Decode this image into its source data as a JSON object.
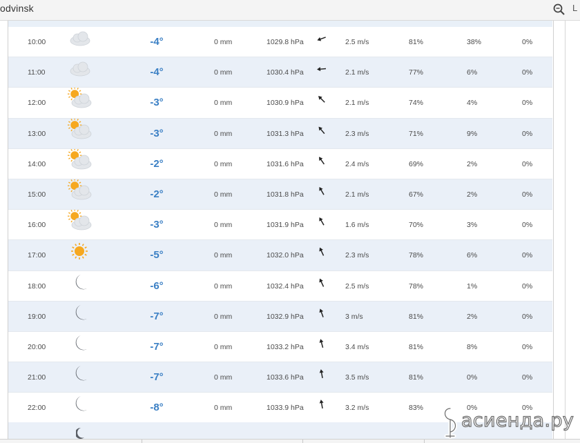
{
  "window": {
    "title": "odvinsk",
    "zoom_icon": "magnifier-icon",
    "cut_label": "L"
  },
  "columns": [
    "time",
    "condition",
    "temperature",
    "precipitation",
    "pressure",
    "wind_direction",
    "wind_speed",
    "humidity",
    "probability",
    "last"
  ],
  "rows": [
    {
      "time": "10:00",
      "icon": "cloud",
      "temp": "-4°",
      "precip": "0 mm",
      "pressure": "1029.8 hPa",
      "wind_dir_deg": 250,
      "wind": "2.5 m/s",
      "humidity": "81%",
      "prob": "38%",
      "last": "0%"
    },
    {
      "time": "11:00",
      "icon": "cloud",
      "temp": "-4°",
      "precip": "0 mm",
      "pressure": "1030.4 hPa",
      "wind_dir_deg": 265,
      "wind": "2.1 m/s",
      "humidity": "77%",
      "prob": "6%",
      "last": "0%"
    },
    {
      "time": "12:00",
      "icon": "sun-cloud",
      "temp": "-3°",
      "precip": "0 mm",
      "pressure": "1030.9 hPa",
      "wind_dir_deg": 315,
      "wind": "2.1 m/s",
      "humidity": "74%",
      "prob": "4%",
      "last": "0%"
    },
    {
      "time": "13:00",
      "icon": "sun-cloud",
      "temp": "-3°",
      "precip": "0 mm",
      "pressure": "1031.3 hPa",
      "wind_dir_deg": 320,
      "wind": "2.3 m/s",
      "humidity": "71%",
      "prob": "9%",
      "last": "0%"
    },
    {
      "time": "14:00",
      "icon": "sun-cloud",
      "temp": "-2°",
      "precip": "0 mm",
      "pressure": "1031.6 hPa",
      "wind_dir_deg": 325,
      "wind": "2.4 m/s",
      "humidity": "69%",
      "prob": "2%",
      "last": "0%"
    },
    {
      "time": "15:00",
      "icon": "sun-cloud",
      "temp": "-2°",
      "precip": "0 mm",
      "pressure": "1031.8 hPa",
      "wind_dir_deg": 330,
      "wind": "2.1 m/s",
      "humidity": "67%",
      "prob": "2%",
      "last": "0%"
    },
    {
      "time": "16:00",
      "icon": "sun-cloud",
      "temp": "-3°",
      "precip": "0 mm",
      "pressure": "1031.9 hPa",
      "wind_dir_deg": 330,
      "wind": "1.6 m/s",
      "humidity": "70%",
      "prob": "3%",
      "last": "0%"
    },
    {
      "time": "17:00",
      "icon": "sun",
      "temp": "-5°",
      "precip": "0 mm",
      "pressure": "1032.0 hPa",
      "wind_dir_deg": 335,
      "wind": "2.3 m/s",
      "humidity": "78%",
      "prob": "6%",
      "last": "0%"
    },
    {
      "time": "18:00",
      "icon": "moon",
      "temp": "-6°",
      "precip": "0 mm",
      "pressure": "1032.4 hPa",
      "wind_dir_deg": 335,
      "wind": "2.5 m/s",
      "humidity": "78%",
      "prob": "1%",
      "last": "0%"
    },
    {
      "time": "19:00",
      "icon": "moon",
      "temp": "-7°",
      "precip": "0 mm",
      "pressure": "1032.9 hPa",
      "wind_dir_deg": 340,
      "wind": "3 m/s",
      "humidity": "81%",
      "prob": "2%",
      "last": "0%"
    },
    {
      "time": "20:00",
      "icon": "moon",
      "temp": "-7°",
      "precip": "0 mm",
      "pressure": "1033.2 hPa",
      "wind_dir_deg": 345,
      "wind": "3.4 m/s",
      "humidity": "81%",
      "prob": "8%",
      "last": "0%"
    },
    {
      "time": "21:00",
      "icon": "moon",
      "temp": "-7°",
      "precip": "0 mm",
      "pressure": "1033.6 hPa",
      "wind_dir_deg": 350,
      "wind": "3.5 m/s",
      "humidity": "81%",
      "prob": "0%",
      "last": "0%"
    },
    {
      "time": "22:00",
      "icon": "moon",
      "temp": "-8°",
      "precip": "0 mm",
      "pressure": "1033.9 hPa",
      "wind_dir_deg": 350,
      "wind": "3.2 m/s",
      "humidity": "83%",
      "prob": "0%",
      "last": "0%"
    }
  ],
  "partial_row_icon": "moon",
  "watermark": {
    "text": "асиенда.ру",
    "logo": "asienda-logo"
  },
  "colors": {
    "temperature": "#3a7fc4",
    "alt_row": "#eaf0f8",
    "sun": "#f6a820",
    "moon": "#5a5f66",
    "cloud": "#e3e6ea"
  }
}
